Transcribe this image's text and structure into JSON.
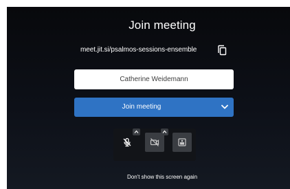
{
  "prejoin": {
    "title": "Join meeting",
    "meeting_url": "meet.jit.si/psalmos-sessions-ensemble",
    "copy_icon": "copy-icon",
    "display_name_value": "Catherine Weidemann",
    "join_button_label": "Join meeting",
    "join_options_icon": "chevron-down-icon",
    "toolbar": {
      "mic_icon": "microphone-muted-icon",
      "camera_icon": "camera-off-icon",
      "background_icon": "virtual-background-icon",
      "caret_icon": "chevron-up-icon"
    },
    "dont_show_label": "Don't show this screen again"
  },
  "colors": {
    "background": "#0d1018",
    "accent": "#2f73c4",
    "input_background": "#ffffff",
    "tool_background": "#3a3d42"
  }
}
